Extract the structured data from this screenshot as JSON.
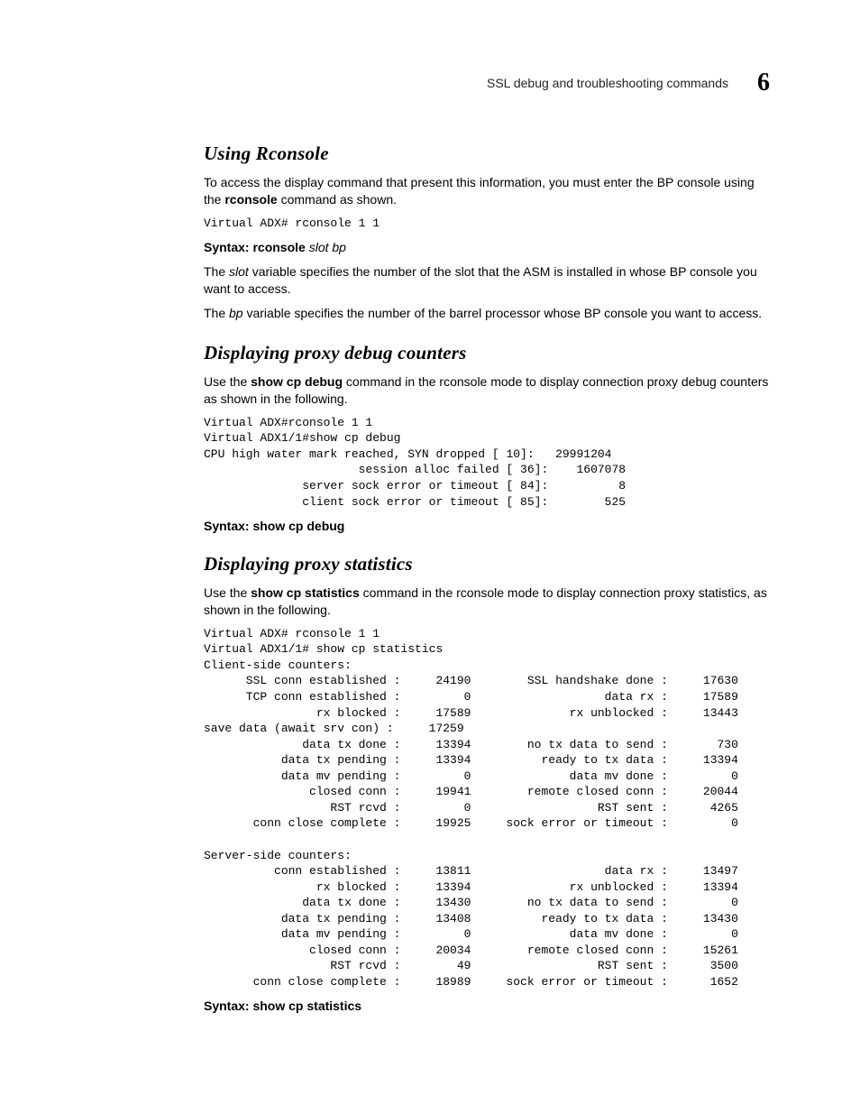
{
  "header": {
    "running_title": "SSL debug and troubleshooting commands",
    "chapter_number": "6"
  },
  "sections": {
    "rconsole": {
      "heading": "Using Rconsole",
      "intro_pre": "To access the display command that present this information, you must enter the BP console using the ",
      "intro_cmd": "rconsole",
      "intro_post": " command as shown.",
      "code": "Virtual ADX# rconsole 1 1",
      "syntax_label": "Syntax:",
      "syntax_cmd": " rconsole ",
      "syntax_args": "slot bp",
      "p_slot_pre": "The ",
      "p_slot_var": "slot",
      "p_slot_post": " variable specifies the number of the slot that the ASM is installed in whose BP console you want to access.",
      "p_bp_pre": "The ",
      "p_bp_var": "bp",
      "p_bp_post": " variable specifies the number of the barrel processor whose BP console you want to access."
    },
    "debug": {
      "heading": "Displaying proxy debug counters",
      "intro_pre": "Use the ",
      "intro_cmd": "show cp debug",
      "intro_post": " command in the rconsole mode to display connection proxy debug counters as shown in the following.",
      "code": "Virtual ADX#rconsole 1 1\nVirtual ADX1/1#show cp debug\nCPU high water mark reached, SYN dropped [ 10]:   29991204\n                      session alloc failed [ 36]:    1607078\n              server sock error or timeout [ 84]:          8\n              client sock error or timeout [ 85]:        525",
      "syntax_label": "Syntax:",
      "syntax_cmd": " show cp debug"
    },
    "stats": {
      "heading": "Displaying proxy statistics",
      "intro_pre": "Use the ",
      "intro_cmd": "show cp statistics",
      "intro_post": " command in the rconsole mode to display connection proxy statistics, as shown in the following.",
      "code": "Virtual ADX# rconsole 1 1\nVirtual ADX1/1# show cp statistics\nClient-side counters:\n      SSL conn established :     24190        SSL handshake done :     17630\n      TCP conn established :         0                   data rx :     17589\n                rx blocked :     17589              rx unblocked :     13443\nsave data (await srv con) :     17259\n              data tx done :     13394        no tx data to send :       730\n           data tx pending :     13394          ready to tx data :     13394\n           data mv pending :         0              data mv done :         0\n               closed conn :     19941        remote closed conn :     20044\n                  RST rcvd :         0                  RST sent :      4265\n       conn close complete :     19925     sock error or timeout :         0\n\nServer-side counters:\n          conn established :     13811                   data rx :     13497\n                rx blocked :     13394              rx unblocked :     13394\n              data tx done :     13430        no tx data to send :         0\n           data tx pending :     13408          ready to tx data :     13430\n           data mv pending :         0              data mv done :         0\n               closed conn :     20034        remote closed conn :     15261\n                  RST rcvd :        49                  RST sent :      3500\n       conn close complete :     18989     sock error or timeout :      1652",
      "syntax_label": "Syntax:",
      "syntax_cmd": " show cp statistics"
    }
  }
}
